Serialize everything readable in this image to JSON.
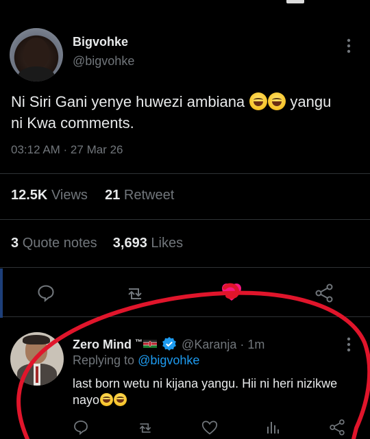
{
  "tweet": {
    "display_name": "Bigvohke",
    "handle": "@bigvohke",
    "text_line1": "Ni Siri Gani yenye huwezi ambiana",
    "text_line1_end": "yangu",
    "text_line2": "ni Kwa comments.",
    "timestamp": "03:12 AM · 27 Mar 26",
    "stats": {
      "views_count": "12.5K",
      "views_label": "Views",
      "retweets_count": "21",
      "retweets_label": "Retweet",
      "quotes_count": "3",
      "quotes_label": "Quote notes",
      "likes_count": "3,693",
      "likes_label": "Likes"
    },
    "icons": [
      "more-icon",
      "reply-icon",
      "retweet-icon",
      "like-icon",
      "share-icon"
    ],
    "like_color": "#f91880"
  },
  "reply": {
    "display_name": "Zero Mind",
    "name_suffix": "™",
    "handle": "@Karanja",
    "time": "· 1m",
    "replying_prefix": "Replying to",
    "replying_handle": "@bigvohke",
    "text_line1": "last born wetu ni kijana yangu. Hii ni heri nizikwe",
    "text_line2": "nayo",
    "verified_color": "#1d9bf0",
    "icons": [
      "more-icon",
      "verified-badge-icon",
      "kenya-flag-icon",
      "reply-icon",
      "retweet-icon",
      "like-icon",
      "analytics-icon",
      "share-icon"
    ]
  },
  "colors": {
    "background": "#000000",
    "text": "#e7e9ea",
    "muted": "#71767b",
    "link": "#1d9bf0",
    "annotation_circle": "#e0152b"
  }
}
